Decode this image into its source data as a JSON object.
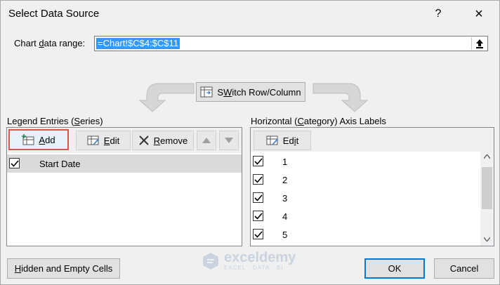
{
  "dialog": {
    "title": "Select Data Source",
    "help_label": "?",
    "close_label": "×"
  },
  "range": {
    "label_pre": "Chart ",
    "label_u": "d",
    "label_post": "ata range:",
    "value": "=Chart!$C$4:$C$11"
  },
  "switch_button": {
    "label_u": "W",
    "label_pre": "S",
    "label_post": "itch Row/Column"
  },
  "legend": {
    "header_pre": "Legend Entries (",
    "header_u": "S",
    "header_post": "eries)",
    "add_pre": "",
    "add_u": "A",
    "add_post": "dd",
    "edit_pre": "",
    "edit_u": "E",
    "edit_post": "dit",
    "remove_pre": "",
    "remove_u": "R",
    "remove_post": "emove",
    "items": [
      {
        "label": "Start Date",
        "checked": true
      }
    ]
  },
  "axis": {
    "header_pre": "Horizontal (",
    "header_u": "C",
    "header_post": "ategory) Axis Labels",
    "edit_pre": "Ed",
    "edit_u": "i",
    "edit_post": "t",
    "items": [
      {
        "label": "1",
        "checked": true
      },
      {
        "label": "2",
        "checked": true
      },
      {
        "label": "3",
        "checked": true
      },
      {
        "label": "4",
        "checked": true
      },
      {
        "label": "5",
        "checked": true
      }
    ]
  },
  "footer": {
    "hidden_pre": "",
    "hidden_u": "H",
    "hidden_post": "idden and Empty Cells",
    "ok_label": "OK",
    "cancel_label": "Cancel"
  },
  "watermark": {
    "name": "exceldemy",
    "tagline": "EXCEL · DATA · BI"
  },
  "colors": {
    "highlight": "#3399ff",
    "add_outline": "#d9534f",
    "selected_row": "#dadada"
  }
}
